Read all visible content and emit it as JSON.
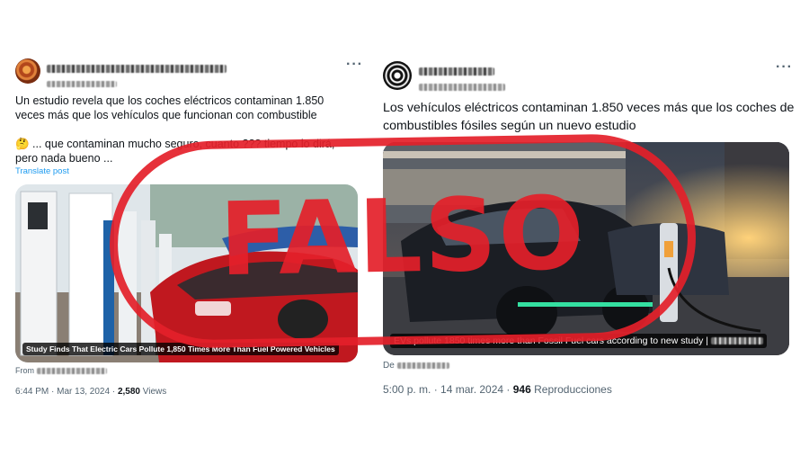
{
  "post_left": {
    "text_main": "Un estudio revela que los coches eléctricos contaminan 1.850 veces más que los vehículos que funcionan con combustible",
    "text_secondary": "🤔 ... que contaminan mucho seguro, cuanto ??? tiempo lo dirá, pero nada bueno ...",
    "translate_label": "Translate post",
    "card_caption": "Study Finds That Electric Cars Pollute 1,850 Times More Than Fuel Powered Vehicles",
    "from_label": "From",
    "meta_time": "6:44 PM · Mar 13, 2024 · ",
    "meta_views_count": "2,580",
    "meta_views_label": " Views",
    "more_icon": "more-horizontal-icon"
  },
  "post_right": {
    "text_main": "Los vehículos eléctricos contaminan 1.850 veces más que los coches de combustibles fósiles según un nuevo estudio",
    "card_caption": "EVs pollute 1850 times more than Fossil Fuel cars according to new study |",
    "from_label": "De",
    "meta_time": "5:00 p. m. · 14 mar. 2024 · ",
    "meta_views_count": "946",
    "meta_views_label": " Reproducciones",
    "more_icon": "more-horizontal-icon"
  },
  "stamp": {
    "label": "FALSO",
    "color": "#e4202a"
  },
  "colors": {
    "text_primary": "#0f1419",
    "text_secondary": "#536471",
    "link": "#1d9bf0"
  }
}
